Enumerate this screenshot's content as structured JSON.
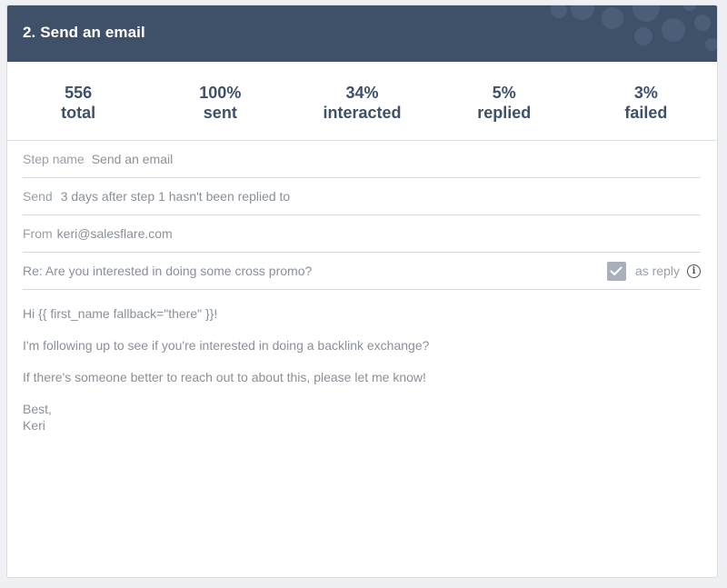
{
  "header": {
    "title": "2. Send an email"
  },
  "stats": [
    {
      "value": "556",
      "label": "total"
    },
    {
      "value": "100%",
      "label": "sent"
    },
    {
      "value": "34%",
      "label": "interacted"
    },
    {
      "value": "5%",
      "label": "replied"
    },
    {
      "value": "3%",
      "label": "failed"
    }
  ],
  "fields": {
    "step_name": {
      "label": "Step name",
      "value": "Send an email"
    },
    "send": {
      "label": "Send",
      "value": "3 days after step 1 hasn't been replied to"
    },
    "from": {
      "label": "From",
      "value": "keri@salesflare.com"
    },
    "subject": {
      "value": "Re: Are you interested in doing some cross promo?",
      "reply_label": "as reply",
      "reply_checked": true
    }
  },
  "email_body": {
    "greeting": "Hi {{ first_name fallback=\"there\" }}!",
    "line1": "I'm following up to see if you're interested in doing a backlink exchange?",
    "line2": "If there's someone better to reach out to about this, please let me know!",
    "signoff": "Best,",
    "signature": "Keri"
  },
  "colors": {
    "header_bg": "#3f5069",
    "stat_text": "#3f5069",
    "muted_text": "#8a9099"
  }
}
